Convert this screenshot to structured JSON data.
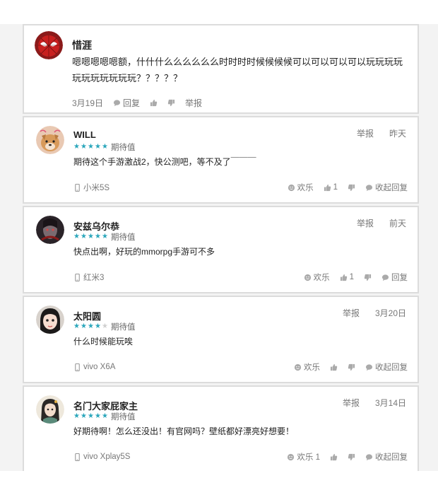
{
  "comments": [
    {
      "username": "惜涯",
      "content": "嗯嗯嗯嗯嗯额，什什什么么么么么么时时时时候候候候可以可以可以可以玩玩玩玩玩玩玩玩玩玩玩？？？？？",
      "date": "3月19日",
      "reply_label": "回复",
      "report_label": "举报"
    },
    {
      "username": "WILL",
      "rating": 5,
      "rating_label": "期待值",
      "report_label": "举报",
      "time": "昨天",
      "content": "期待这个手游激战2，快公测吧，等不及了￣￣￣",
      "device": "小米5S",
      "fun_label": "欢乐",
      "like_count": "1",
      "reply_label": "收起回复"
    },
    {
      "username": "安兹乌尔恭",
      "rating": 5,
      "rating_label": "期待值",
      "report_label": "举报",
      "time": "前天",
      "content": "快点出啊，好玩的mmorpg手游可不多",
      "device": "红米3",
      "fun_label": "欢乐",
      "like_count": "1",
      "reply_label": "回复"
    },
    {
      "username": "太阳圆",
      "rating": 4,
      "rating_label": "期待值",
      "report_label": "举报",
      "time": "3月20日",
      "content": "什么时候能玩唉",
      "device": "vivo X6A",
      "fun_label": "欢乐",
      "like_count": "",
      "reply_label": "收起回复"
    },
    {
      "username": "名门大家屁家主",
      "rating": 5,
      "rating_label": "期待值",
      "report_label": "举报",
      "time": "3月14日",
      "content": "好期待啊！怎么还没出！有官网吗？壁纸都好漂亮好想要！",
      "device": "vivo Xplay5S",
      "fun_label": "欢乐 1",
      "like_count": "",
      "reply_label": "收起回复"
    }
  ],
  "colors": {
    "star_on": "#2aa6bb",
    "star_off": "#cfcfcf",
    "card_border": "#dcdcdc"
  }
}
